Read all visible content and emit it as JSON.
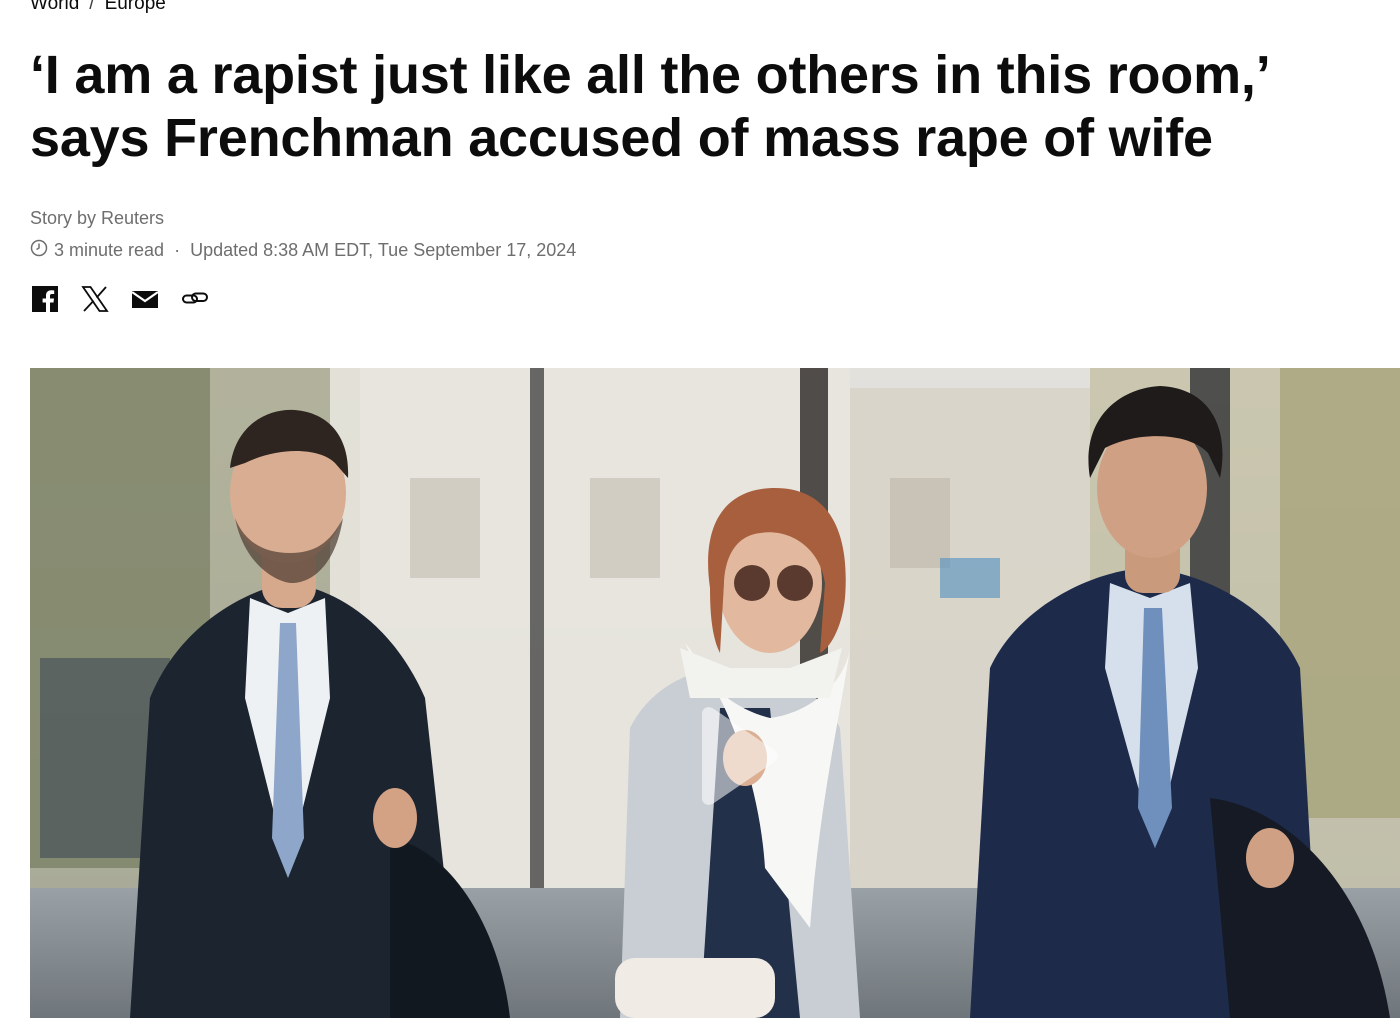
{
  "breadcrumb": {
    "items": [
      "World",
      "Europe"
    ],
    "separator": "/"
  },
  "article": {
    "headline_line1": "‘I am a rapist just like all the others in this room,’",
    "headline_line2": "says Frenchman accused of mass rape of wife",
    "byline": "Story by Reuters",
    "read_time": "3 minute read",
    "meta_separator": "·",
    "updated": "Updated 8:38 AM EDT, Tue September 17, 2024"
  },
  "share": {
    "icons": [
      "facebook-icon",
      "x-icon",
      "email-icon",
      "link-icon"
    ]
  },
  "media": {
    "type": "video",
    "play_icon": "play-icon"
  },
  "colors": {
    "text": "#0c0c0c",
    "meta": "#6e6e6e"
  }
}
